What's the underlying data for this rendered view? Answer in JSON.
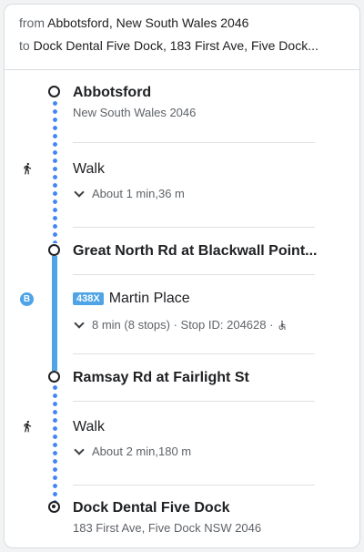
{
  "header": {
    "from_prefix": "from",
    "from_value": "Abbotsford, New South Wales 2046",
    "to_prefix": "to",
    "to_value": "Dock Dental Five Dock, 183 First Ave, Five Dock..."
  },
  "steps": {
    "origin": {
      "title": "Abbotsford",
      "subtitle": "New South Wales 2046"
    },
    "walk1": {
      "label": "Walk",
      "detail": "About 1 min,36 m",
      "icon": "walk-icon"
    },
    "stop1": {
      "title": "Great North Rd at Blackwall Point..."
    },
    "bus": {
      "icon_letter": "B",
      "route": "438X",
      "headsign": "Martin Place",
      "detail": "8 min (8 stops) · Stop ID: 204628 ·",
      "accessibility_icon": "wheelchair-icon"
    },
    "stop2": {
      "title": "Ramsay Rd at Fairlight St"
    },
    "walk2": {
      "label": "Walk",
      "detail": "About 2 min,180 m",
      "icon": "walk-icon"
    },
    "destination": {
      "title": "Dock Dental Five Dock",
      "subtitle": "183 First Ave, Five Dock NSW 2046"
    }
  },
  "colors": {
    "walk_dots": "#4285f4",
    "bus_line": "#4ea4e6",
    "badge": "#4ea4e6"
  }
}
